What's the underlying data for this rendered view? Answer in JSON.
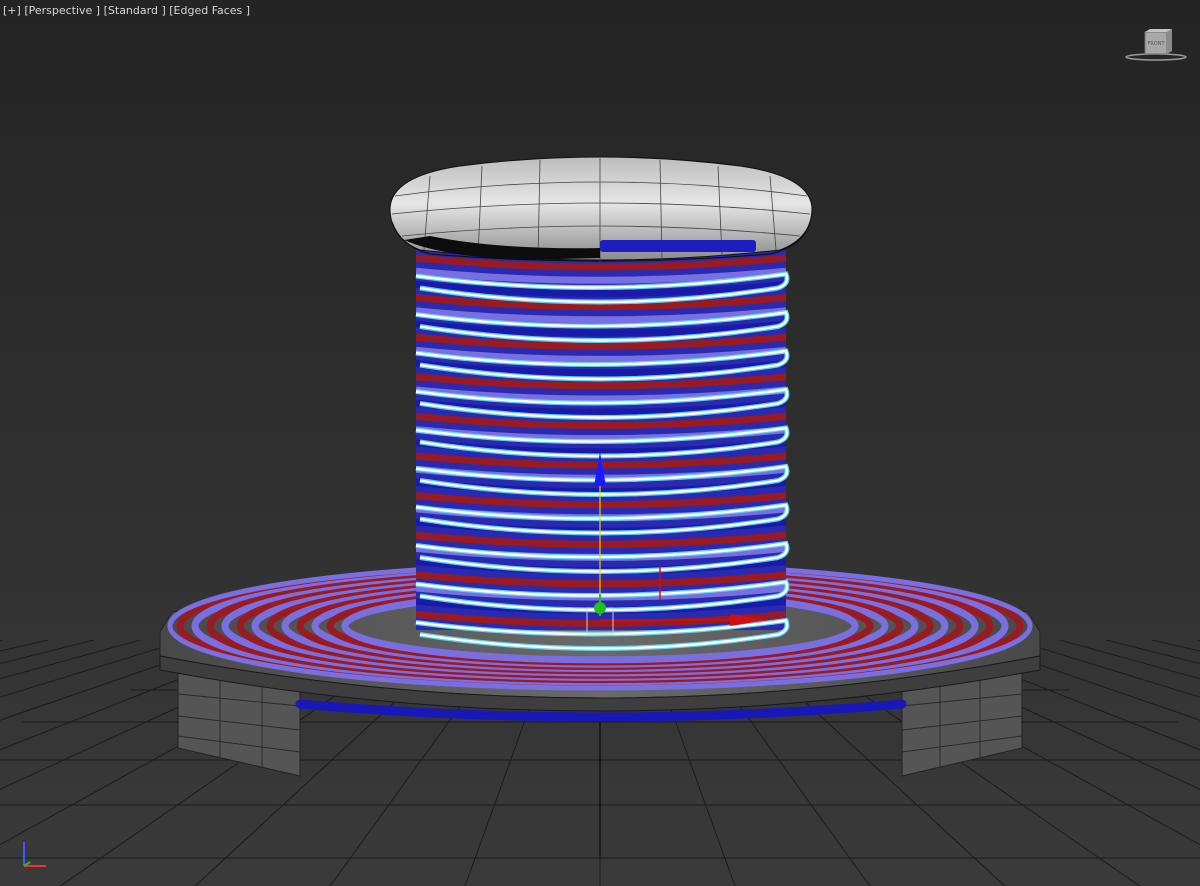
{
  "viewport": {
    "labels": [
      {
        "text": "[+]"
      },
      {
        "text": "[Perspective ]"
      },
      {
        "text": "[Standard ]"
      },
      {
        "text": "[Edged Faces ]"
      }
    ],
    "viewcube_face": "FRONT"
  },
  "colors": {
    "background": "#2e2e2e",
    "grid": "#1d1d1d",
    "spiral_red": "#9a1a22",
    "spiral_blue": "#7a6fe0",
    "coil_dark_blue": "#1a1aa8",
    "wire_highlight": "#ffffff",
    "wire_glow": "#5fe0ff",
    "gizmo_x": "#d01010",
    "gizmo_y": "#20c020",
    "gizmo_z": "#1a1aff",
    "base_gray": "#5a5a5a"
  },
  "icons": {
    "viewcube": "viewcube-icon",
    "axis_tripod": "axis-tripod-icon",
    "transform_gizmo": "move-gizmo-icon"
  }
}
